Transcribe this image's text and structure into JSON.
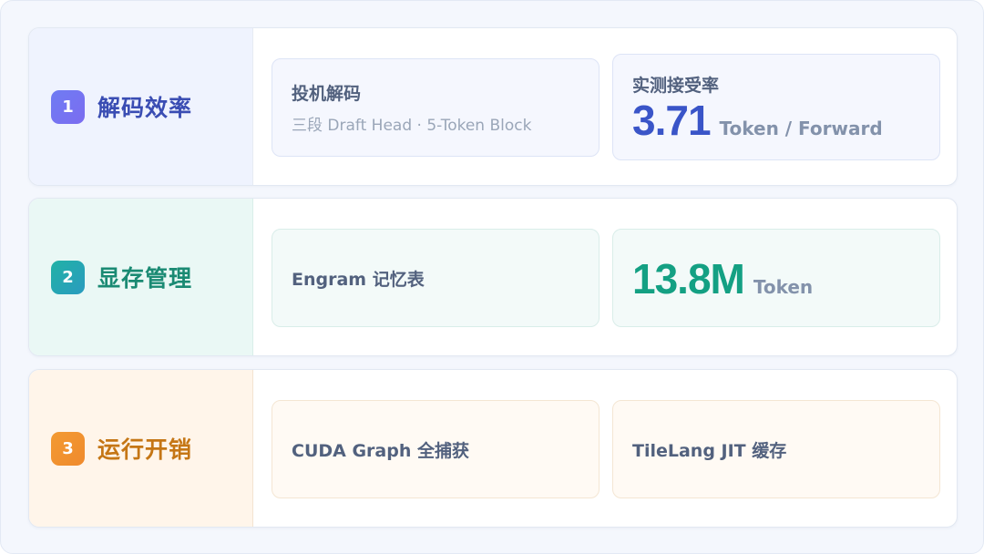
{
  "rows": [
    {
      "number": "1",
      "label": "解码效率",
      "left_card": {
        "title": "投机解码",
        "subtitle": "三段 Draft Head · 5-Token Block"
      },
      "right_card": {
        "title": "实测接受率",
        "value": "3.71",
        "unit": "Token / Forward"
      }
    },
    {
      "number": "2",
      "label": "显存管理",
      "left_card": {
        "title": "Engram 记忆表"
      },
      "right_card": {
        "value": "13.8M",
        "unit": "Token"
      }
    },
    {
      "number": "3",
      "label": "运行开销",
      "left_card": {
        "title": "CUDA Graph 全捕获"
      },
      "right_card": {
        "title": "TileLang JIT 缓存"
      }
    }
  ],
  "colors": {
    "row1_accent": "#3a4db3",
    "row2_accent": "#1a8a73",
    "row3_accent": "#c57615"
  }
}
